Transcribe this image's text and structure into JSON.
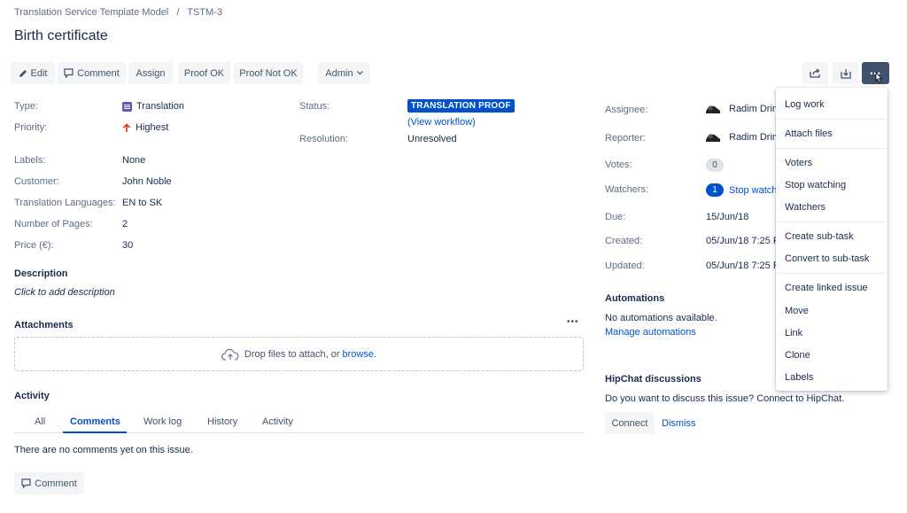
{
  "breadcrumb": {
    "project": "Translation Service Template Model",
    "separator": "/",
    "issue_key": "TSTM-3"
  },
  "issue": {
    "title": "Birth certificate"
  },
  "toolbar": {
    "edit": "Edit",
    "comment": "Comment",
    "assign": "Assign",
    "proof_ok": "Proof OK",
    "proof_not_ok": "Proof Not OK",
    "admin": "Admin"
  },
  "details": {
    "type_label": "Type:",
    "type_value": "Translation",
    "priority_label": "Priority:",
    "priority_value": "Highest",
    "labels_label": "Labels:",
    "labels_value": "None",
    "customer_label": "Customer:",
    "customer_value": "John Noble",
    "languages_label": "Translation Languages:",
    "languages_value": "EN to SK",
    "pages_label": "Number of Pages:",
    "pages_value": "2",
    "price_label": "Price (€):",
    "price_value": "30",
    "status_label": "Status:",
    "status_value": "TRANSLATION PROOF",
    "view_workflow": "(View workflow)",
    "resolution_label": "Resolution:",
    "resolution_value": "Unresolved"
  },
  "description": {
    "heading": "Description",
    "placeholder": "Click to add description"
  },
  "attachments": {
    "heading": "Attachments",
    "more": "•••",
    "drop_text": "Drop files to attach, or",
    "browse": "browse",
    "period": "."
  },
  "activity": {
    "heading": "Activity",
    "tabs": [
      "All",
      "Comments",
      "Work log",
      "History",
      "Activity"
    ],
    "empty": "There are no comments yet on this issue.",
    "comment_button": "Comment"
  },
  "people": {
    "assignee_label": "Assignee:",
    "assignee_value": "Radim Drin",
    "reporter_label": "Reporter:",
    "reporter_value": "Radim Drin",
    "votes_label": "Votes:",
    "votes_count": "0",
    "watchers_label": "Watchers:",
    "watchers_count": "1",
    "stop_watching": "Stop watch"
  },
  "dates": {
    "due_label": "Due:",
    "due_value": "15/Jun/18",
    "created_label": "Created:",
    "created_value": "05/Jun/18 7:25 P",
    "updated_label": "Updated:",
    "updated_value": "05/Jun/18 7:25 P"
  },
  "automations": {
    "heading": "Automations",
    "none": "No automations available.",
    "manage": "Manage automations"
  },
  "hipchat": {
    "heading": "HipChat discussions",
    "prompt": "Do you want to discuss this issue? Connect to HipChat.",
    "connect": "Connect",
    "dismiss": "Dismiss"
  },
  "more_menu": {
    "items": [
      "Log work",
      "Attach files",
      "Voters",
      "Stop watching",
      "Watchers",
      "Create sub-task",
      "Convert to sub-task",
      "Create linked issue",
      "Move",
      "Link",
      "Clone",
      "Labels"
    ]
  },
  "colors": {
    "accent": "#0052cc",
    "button_bg": "#f4f5f7",
    "priority_highest": "#de350b",
    "type_purple": "#6554c0"
  }
}
